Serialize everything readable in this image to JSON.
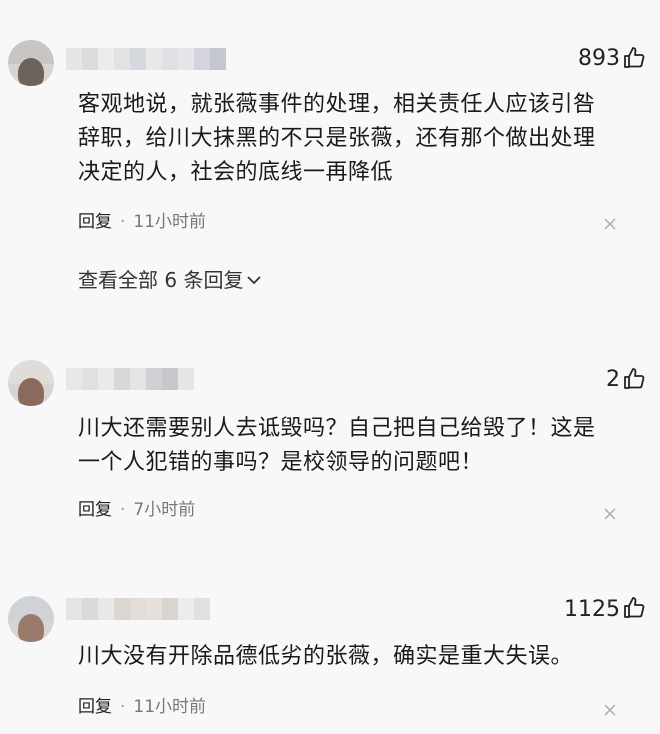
{
  "comments": [
    {
      "likes": "893",
      "text_lines": [
        "客观地说，就张薇事件的处理，相关责任人应该引咎",
        "辞职，给川大抹黑的不只是张薇，还有那个做出处理",
        "决定的人，社会的底线一再降低"
      ],
      "reply_label": "回复",
      "separator": "·",
      "time": "11小时前",
      "expand_label": "查看全部 6 条回复"
    },
    {
      "likes": "2",
      "text_lines": [
        "川大还需要别人去诋毁吗？自己把自己给毁了！这是",
        "一个人犯错的事吗？是校领导的问题吧！"
      ],
      "reply_label": "回复",
      "separator": "·",
      "time": "7小时前"
    },
    {
      "likes": "1125",
      "text_lines": [
        "川大没有开除品德低劣的张薇，确实是重大失误。"
      ],
      "reply_label": "回复",
      "separator": "·",
      "time": "11小时前"
    }
  ],
  "icons": {
    "like": "thumbs-up-icon",
    "dismiss": "close-icon",
    "expand": "chevron-down-icon"
  }
}
